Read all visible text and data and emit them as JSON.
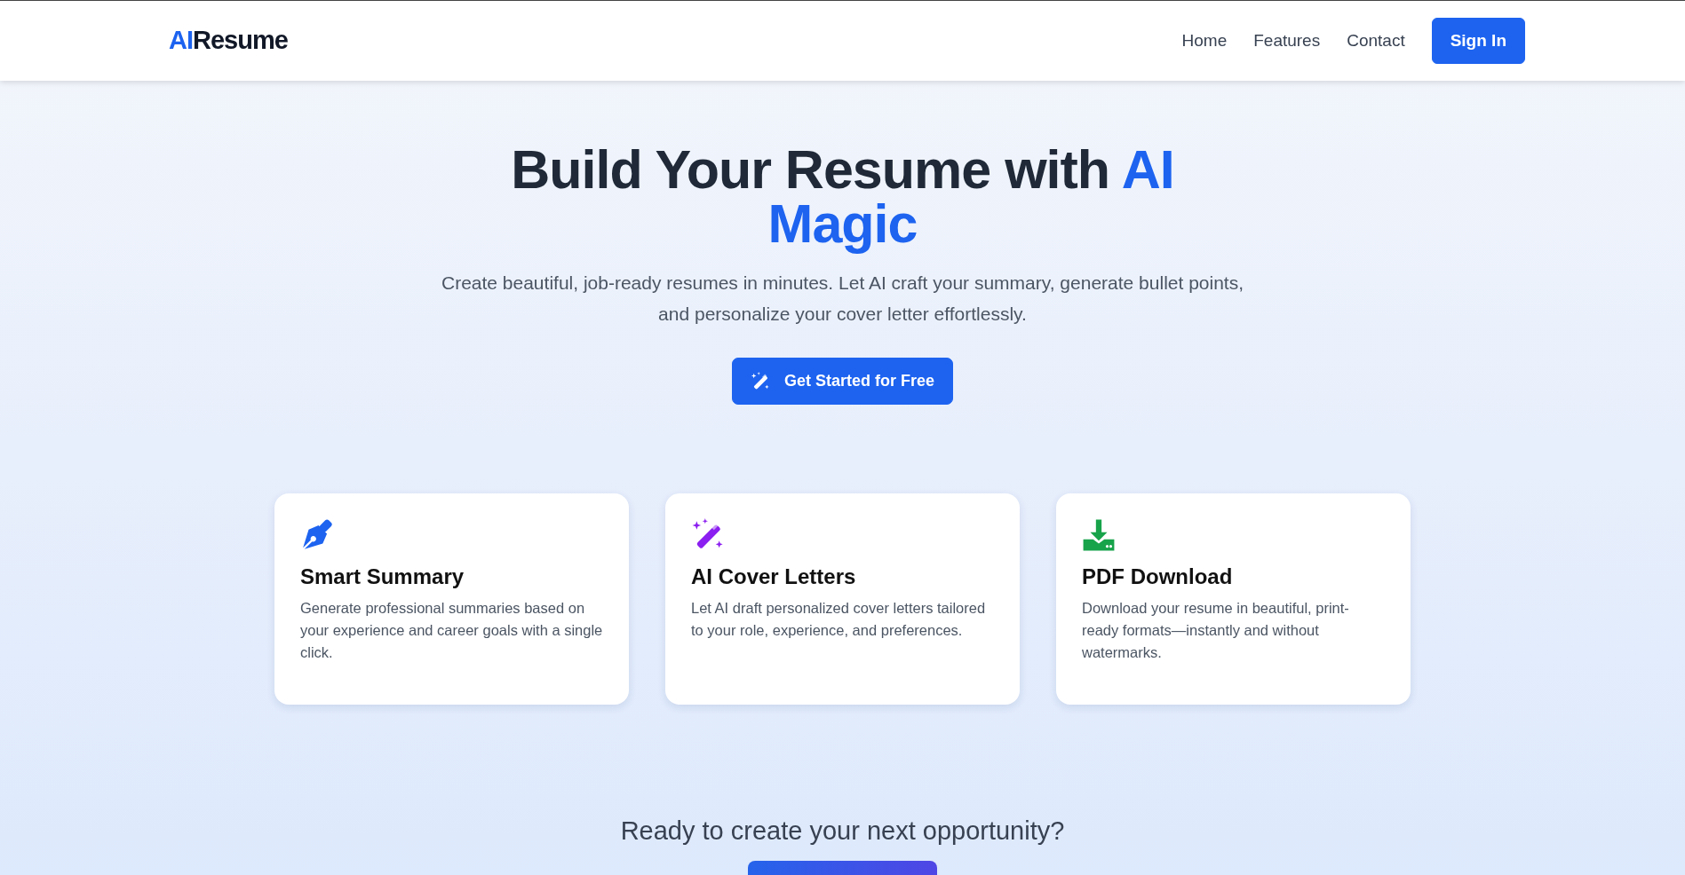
{
  "navbar": {
    "brand": {
      "accent": "AI",
      "rest": "Resume"
    },
    "links": [
      "Home",
      "Features",
      "Contact"
    ],
    "sign_in": "Sign In"
  },
  "hero": {
    "title": "Build Your Resume with",
    "title_accent": "AI Magic",
    "subtitle": "Create beautiful, job-ready resumes in minutes. Let AI craft your summary, generate bullet points, and personalize your cover letter effortlessly.",
    "button": "Get Started for Free"
  },
  "features": [
    {
      "kind": "pen",
      "color": "#1d63f0",
      "title": "Smart Summary",
      "text": "Generate professional summaries based on your experience and career goals with a single click."
    },
    {
      "kind": "wand",
      "color": "#8b1ef0",
      "title": "AI Cover Letters",
      "text": "Let AI draft personalized cover letters tailored to your role, experience, and preferences."
    },
    {
      "kind": "download",
      "color": "#17a34a",
      "title": "PDF Download",
      "text": "Download your resume in beautiful, print-ready formats—instantly and without watermarks."
    }
  ],
  "cta": {
    "heading": "Ready to create your next opportunity?"
  }
}
